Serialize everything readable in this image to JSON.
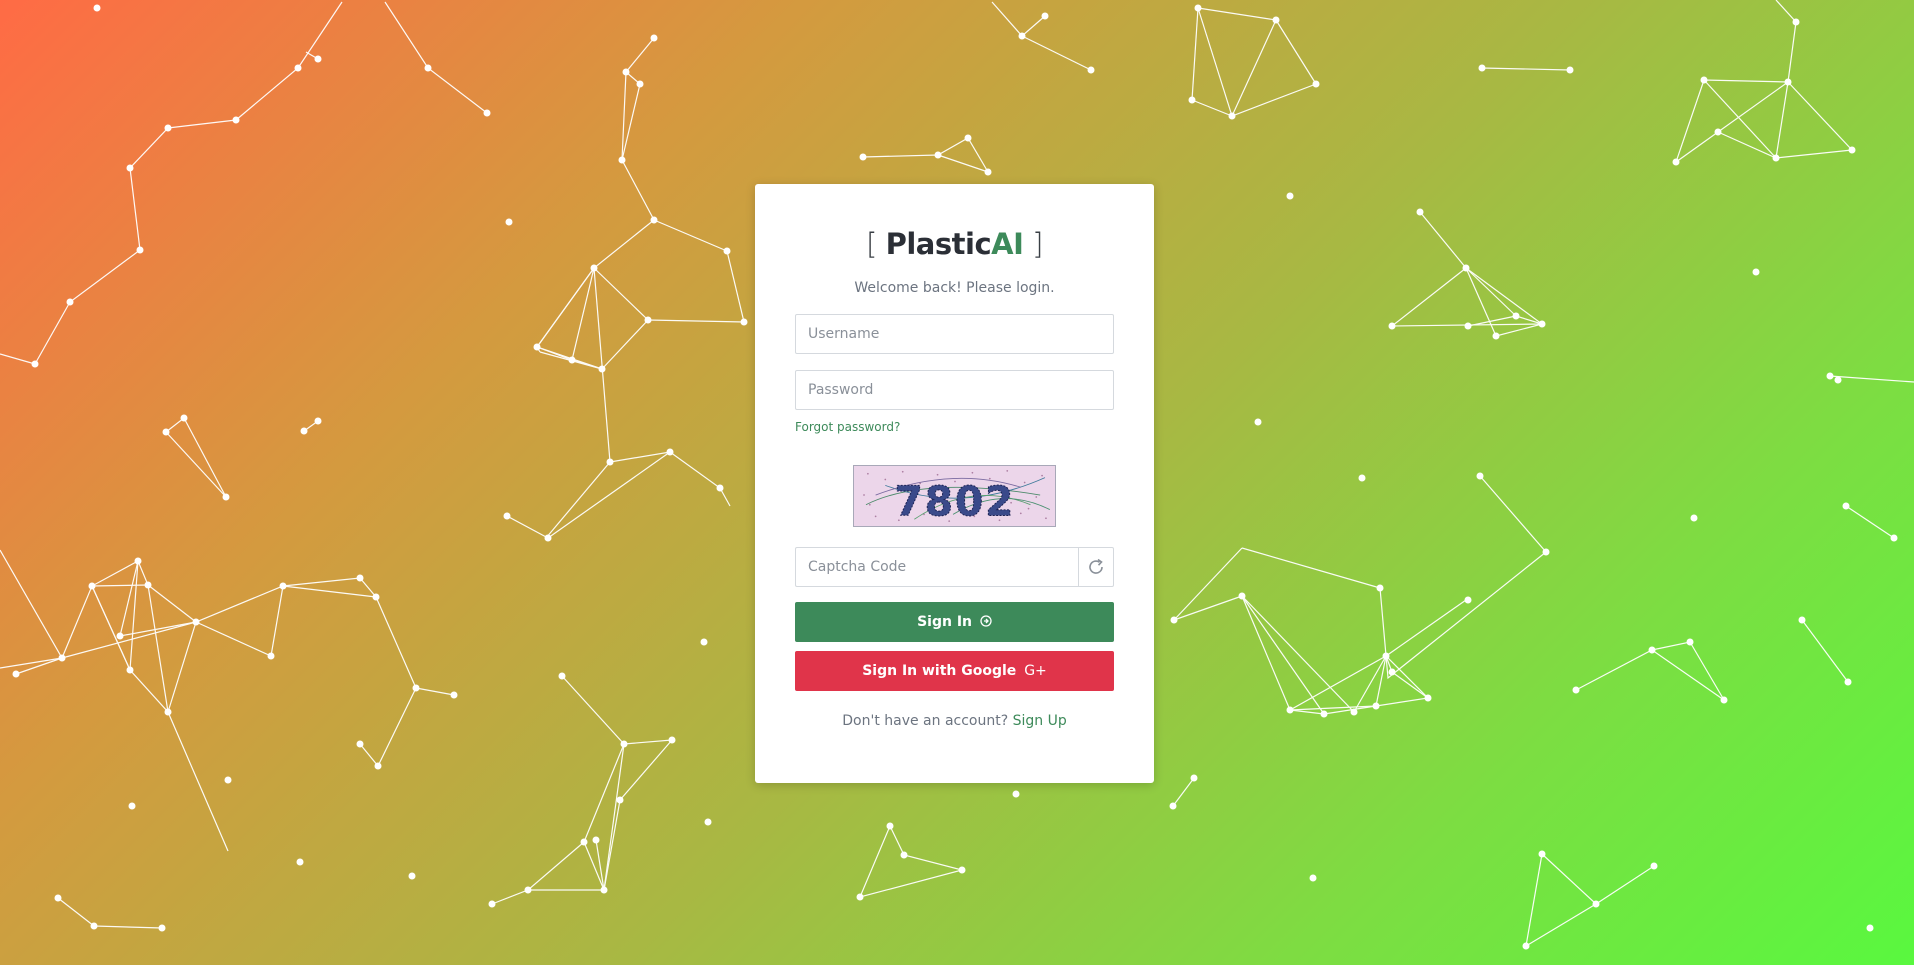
{
  "brand": {
    "open_bracket": "[",
    "name_part1": "Plastic",
    "name_part2": "AI",
    "close_bracket": "]"
  },
  "login": {
    "welcome": "Welcome back! Please login.",
    "username_placeholder": "Username",
    "password_placeholder": "Password",
    "forgot_password": "Forgot password?",
    "captcha_text": "7802",
    "captcha_placeholder": "Captcha Code",
    "sign_in_label": "Sign In",
    "google_label": "Sign In with Google",
    "google_glyph": "G+",
    "no_account_text": "Don't have an account?",
    "sign_up_link": "Sign Up"
  },
  "icons": {
    "refresh": "refresh-icon",
    "sign_in": "arrow-circle-right-icon",
    "google_plus": "google-plus-icon"
  },
  "colors": {
    "primary_green": "#3d8a5a",
    "google_red": "#e0344a",
    "gradient_start": "#ff6b45",
    "gradient_end": "#59f83f"
  }
}
